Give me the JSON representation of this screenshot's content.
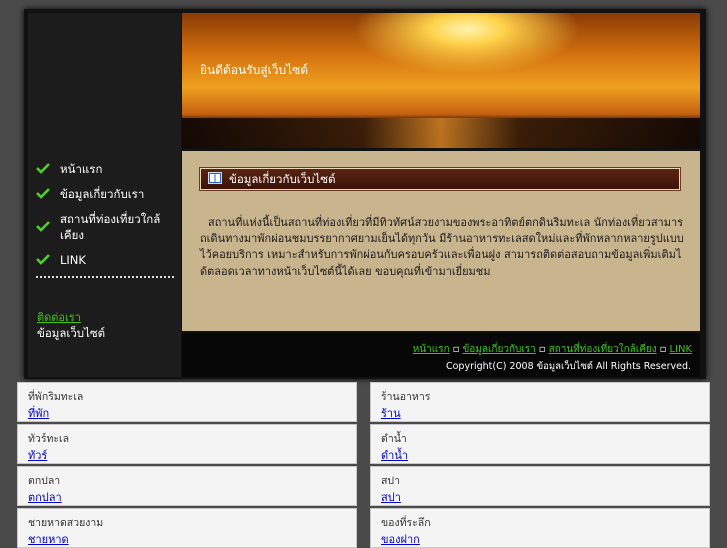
{
  "sidebar": {
    "nav": [
      {
        "label": "หน้าแรก"
      },
      {
        "label": "ข้อมูลเกี่ยวกับเรา"
      },
      {
        "label": "สถานที่ท่องเที่ยวใกล้เคียง"
      },
      {
        "label": "LINK"
      }
    ],
    "green_link": "ติดต่อเรา",
    "white_text": "ข้อมูลเว็บไซต์"
  },
  "hero": {
    "title": "ยินดีต้อนรับสู่เว็บไซต์"
  },
  "content": {
    "heading": "ข้อมูลเกี่ยวกับเว็บไซต์",
    "body": "สถานที่แห่งนี้เป็นสถานที่ท่องเที่ยวที่มีทิวทัศน์สวยงามของพระอาทิตย์ตกดินริมทะเล นักท่องเที่ยวสามารถเดินทางมาพักผ่อนชมบรรยากาศยามเย็นได้ทุกวัน มีร้านอาหารทะเลสดใหม่และที่พักหลากหลายรูปแบบไว้คอยบริการ เหมาะสำหรับการพักผ่อนกับครอบครัวและเพื่อนฝูง สามารถติดต่อสอบถามข้อมูลเพิ่มเติมได้ตลอดเวลาทางหน้าเว็บไซต์นี้ได้เลย ขอบคุณที่เข้ามาเยี่ยมชม"
  },
  "footer": {
    "links": [
      "หน้าแรก",
      "ข้อมูลเกี่ยวกับเรา",
      "สถานที่ท่องเที่ยวใกล้เคียง",
      "LINK"
    ],
    "copyright": "Copyright(C) 2008 ข้อมูลเว็บไซต์ All Rights Reserved."
  },
  "boxes": [
    {
      "title": "ที่พักริมทะเล",
      "link": "ที่พัก"
    },
    {
      "title": "ร้านอาหาร",
      "link": "ร้าน"
    },
    {
      "title": "ทัวร์ทะเล",
      "link": "ทัวร์"
    },
    {
      "title": "ดำน้ำ",
      "link": "ดำน้ำ"
    },
    {
      "title": "ตกปลา",
      "link": "ตกปลา"
    },
    {
      "title": "สปา",
      "link": "สปา"
    },
    {
      "title": "ชายหาดสวยงาม",
      "link": "ชายหาด"
    },
    {
      "title": "ของที่ระลึก",
      "link": "ของฝาก"
    }
  ],
  "colors": {
    "accent_green": "#3fc41f",
    "link_blue": "#0000cc"
  }
}
